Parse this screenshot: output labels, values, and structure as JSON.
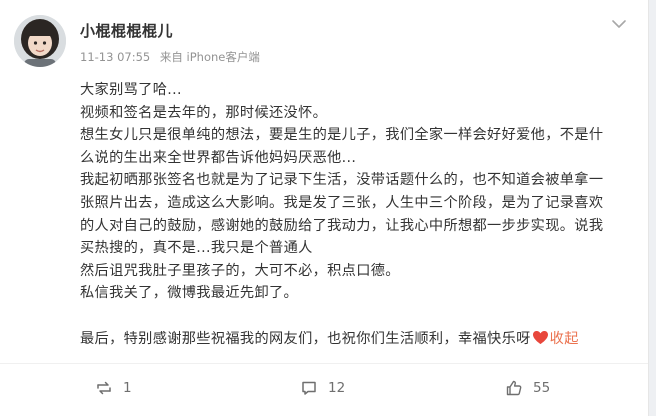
{
  "post": {
    "author": "小棍棍棍棍儿",
    "time": "11-13 07:55",
    "source": "来自 iPhone客户端",
    "lines": [
      "大家别骂了哈...",
      "视频和签名是去年的，那时候还没怀。",
      "想生女儿只是很单纯的想法，要是生的是儿子，我们全家一样会好好爱他，不是什",
      "么说的生出来全世界都告诉他妈妈厌恶他...",
      "我起初晒那张签名也就是为了记录下生活，没带话题什么的，也不知道会被单拿一",
      "张照片出去，造成这么大影响。我是发了三张，人生中三个阶段，是为了记录喜欢",
      "的人对自己的鼓励，感谢她的鼓励给了我动力，让我心中所想都一步步实现。说我",
      "买热搜的，真不是...我只是个普通人",
      "然后诅咒我肚子里孩子的，大可不必，积点口德。",
      "私信我关了，微博我最近先卸了。"
    ],
    "last_line": "最后，特别感谢那些祝福我的网友们，也祝你们生活顺利，幸福快乐呀",
    "collapse_label": "收起"
  },
  "actions": {
    "repost_count": "1",
    "comment_count": "12",
    "like_count": "55"
  },
  "colors": {
    "accent": "#eb7350",
    "heart": "#e8473c",
    "text": "#333333",
    "meta": "#939393"
  },
  "icons": [
    "avatar-photo",
    "chevron-down-icon",
    "repost-icon",
    "comment-icon",
    "like-icon",
    "heart-emoji"
  ]
}
